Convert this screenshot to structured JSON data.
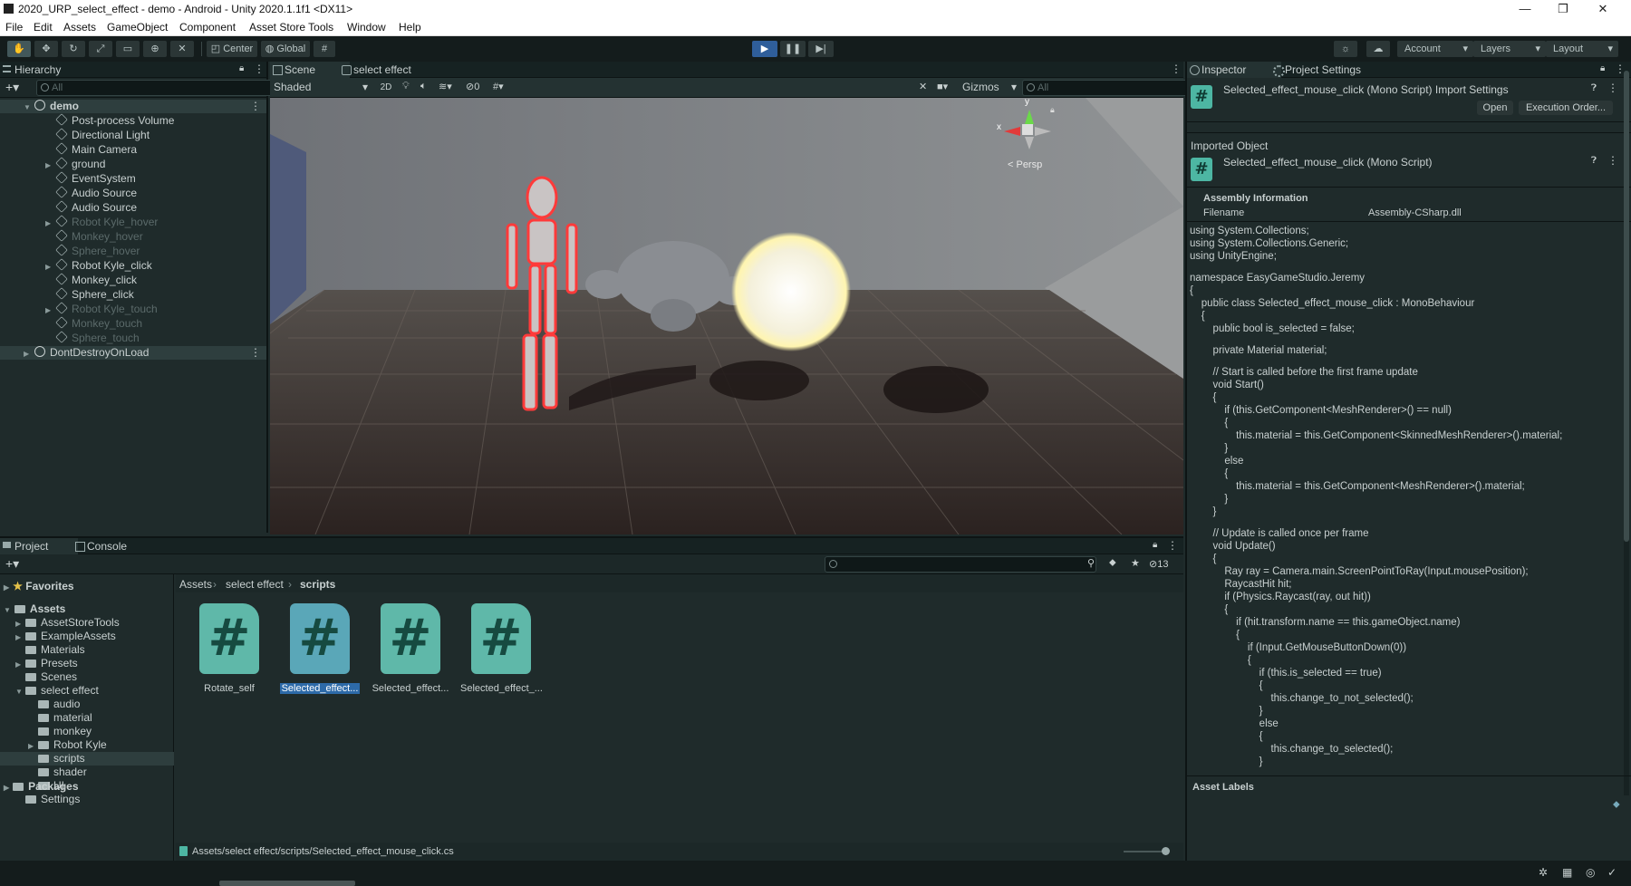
{
  "window": {
    "title": "2020_URP_select_effect - demo - Android - Unity 2020.1.1f1 <DX11>",
    "minimize": "—",
    "maximize": "❐",
    "close": "✕"
  },
  "menu": [
    "File",
    "Edit",
    "Assets",
    "GameObject",
    "Component",
    "Asset Store Tools",
    "Window",
    "Help"
  ],
  "toolbar": {
    "center": "Center",
    "global": "Global",
    "account": "Account",
    "layers": "Layers",
    "layout": "Layout"
  },
  "hierarchy": {
    "tab": "Hierarchy",
    "search_placeholder": "All",
    "root": "demo",
    "items": [
      {
        "label": "Post-process Volume",
        "dim": false,
        "expand": false
      },
      {
        "label": "Directional Light",
        "dim": false,
        "expand": false
      },
      {
        "label": "Main Camera",
        "dim": false,
        "expand": false
      },
      {
        "label": "ground",
        "dim": false,
        "expand": true
      },
      {
        "label": "EventSystem",
        "dim": false,
        "expand": false
      },
      {
        "label": "Audio Source",
        "dim": false,
        "expand": false
      },
      {
        "label": "Audio Source",
        "dim": false,
        "expand": false
      },
      {
        "label": "Robot Kyle_hover",
        "dim": true,
        "expand": true
      },
      {
        "label": "Monkey_hover",
        "dim": true,
        "expand": false
      },
      {
        "label": "Sphere_hover",
        "dim": true,
        "expand": false
      },
      {
        "label": "Robot Kyle_click",
        "dim": false,
        "expand": true
      },
      {
        "label": "Monkey_click",
        "dim": false,
        "expand": false
      },
      {
        "label": "Sphere_click",
        "dim": false,
        "expand": false
      },
      {
        "label": "Robot Kyle_touch",
        "dim": true,
        "expand": true
      },
      {
        "label": "Monkey_touch",
        "dim": true,
        "expand": false
      },
      {
        "label": "Sphere_touch",
        "dim": true,
        "expand": false
      }
    ],
    "dontdestroy": "DontDestroyOnLoad"
  },
  "scene": {
    "tabs": [
      "Scene",
      "select effect"
    ],
    "shading": "Shaded",
    "mode2d": "2D",
    "hidden_count": "0",
    "gizmos": "Gizmos",
    "search_placeholder": "All",
    "persp": "< Persp",
    "axis_x": "x",
    "axis_y": "y"
  },
  "inspector": {
    "tabs": [
      "Inspector",
      "Project Settings"
    ],
    "header_title": "Selected_effect_mouse_click (Mono Script) Import Settings",
    "open": "Open",
    "execution_order": "Execution Order...",
    "imported_object": "Imported Object",
    "object_title": "Selected_effect_mouse_click (Mono Script)",
    "assembly_info": "Assembly Information",
    "filename_label": "Filename",
    "filename_value": "Assembly-CSharp.dll",
    "code": [
      "using System.Collections;",
      "using System.Collections.Generic;",
      "using UnityEngine;",
      "",
      "namespace EasyGameStudio.Jeremy",
      "{",
      "    public class Selected_effect_mouse_click : MonoBehaviour",
      "    {",
      "        public bool is_selected = false;",
      "",
      "        private Material material;",
      "",
      "        // Start is called before the first frame update",
      "        void Start()",
      "        {",
      "            if (this.GetComponent<MeshRenderer>() == null)",
      "            {",
      "                this.material = this.GetComponent<SkinnedMeshRenderer>().material;",
      "            }",
      "            else",
      "            {",
      "                this.material = this.GetComponent<MeshRenderer>().material;",
      "            }",
      "        }",
      "",
      "        // Update is called once per frame",
      "        void Update()",
      "        {",
      "            Ray ray = Camera.main.ScreenPointToRay(Input.mousePosition);",
      "            RaycastHit hit;",
      "            if (Physics.Raycast(ray, out hit))",
      "            {",
      "                if (hit.transform.name == this.gameObject.name)",
      "                {",
      "                    if (Input.GetMouseButtonDown(0))",
      "                    {",
      "                        if (this.is_selected == true)",
      "                        {",
      "                            this.change_to_not_selected();",
      "                        }",
      "                        else",
      "                        {",
      "                            this.change_to_selected();",
      "                        }"
    ],
    "asset_labels": "Asset Labels"
  },
  "project": {
    "tabs": [
      "Project",
      "Console"
    ],
    "hidden_count": "13",
    "breadcrumb": [
      "Assets",
      "select effect",
      "scripts"
    ],
    "favorites": "Favorites",
    "assets_root": "Assets",
    "tree": [
      {
        "label": "AssetStoreTools",
        "depth": 1,
        "expand": true
      },
      {
        "label": "ExampleAssets",
        "depth": 1,
        "expand": true
      },
      {
        "label": "Materials",
        "depth": 1,
        "expand": false
      },
      {
        "label": "Presets",
        "depth": 1,
        "expand": true
      },
      {
        "label": "Scenes",
        "depth": 1,
        "expand": false
      },
      {
        "label": "select effect",
        "depth": 1,
        "expand": "open"
      },
      {
        "label": "audio",
        "depth": 2,
        "expand": false
      },
      {
        "label": "material",
        "depth": 2,
        "expand": false
      },
      {
        "label": "monkey",
        "depth": 2,
        "expand": false
      },
      {
        "label": "Robot Kyle",
        "depth": 2,
        "expand": true
      },
      {
        "label": "scripts",
        "depth": 2,
        "expand": false
      },
      {
        "label": "shader",
        "depth": 2,
        "expand": false
      },
      {
        "label": "UI",
        "depth": 2,
        "expand": false
      },
      {
        "label": "Settings",
        "depth": 1,
        "expand": false
      }
    ],
    "packages": "Packages",
    "assets": [
      {
        "label": "Rotate_self",
        "selected": false
      },
      {
        "label": "Selected_effect...",
        "selected": true
      },
      {
        "label": "Selected_effect...",
        "selected": false
      },
      {
        "label": "Selected_effect_...",
        "selected": false
      }
    ],
    "asset_glyph": "#",
    "footer_path": "Assets/select effect/scripts/Selected_effect_mouse_click.cs"
  },
  "colors": {
    "accent_teal": "#4db6a3",
    "selection_blue": "#2d6aa8",
    "play_blue": "#3d7fd6"
  }
}
